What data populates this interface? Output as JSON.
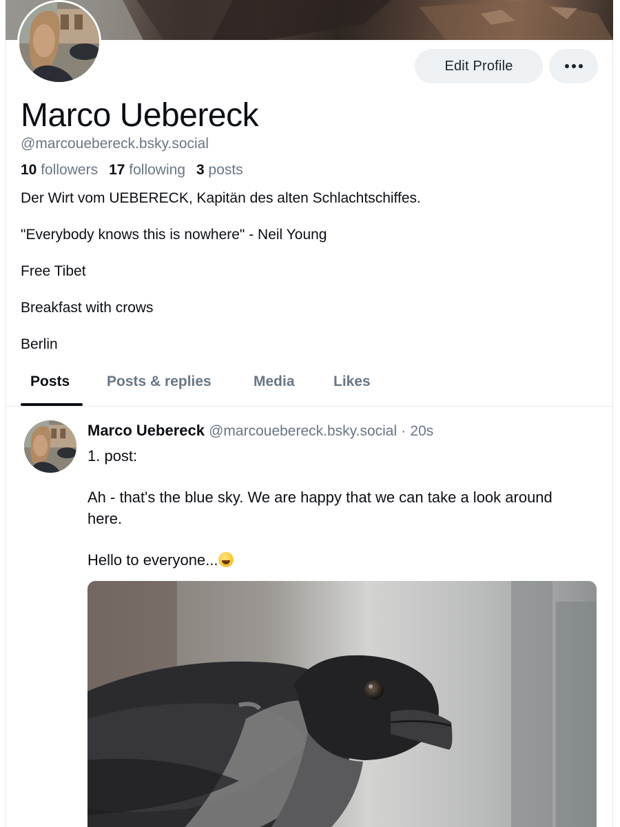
{
  "profile": {
    "name": "Marco Uebereck",
    "handle": "@marcouebereck.bsky.social",
    "followers_count": "10",
    "followers_label": "followers",
    "following_count": "17",
    "following_label": "following",
    "posts_count": "3",
    "posts_label": "posts",
    "bio": [
      "Der Wirt vom UEBERECK, Kapitän des alten Schlachtschiffes.",
      "\"Everybody knows this is nowhere\" - Neil Young",
      "Free Tibet",
      "Breakfast with crows",
      "Berlin"
    ]
  },
  "header": {
    "edit_profile_label": "Edit Profile",
    "more_icon": "more-horizontal-icon"
  },
  "tabs": [
    {
      "label": "Posts",
      "active": true
    },
    {
      "label": "Posts & replies",
      "active": false
    },
    {
      "label": "Media",
      "active": false
    },
    {
      "label": "Likes",
      "active": false
    }
  ],
  "post": {
    "author": "Marco Uebereck",
    "handle": "@marcouebereck.bsky.social",
    "separator": "·",
    "time": "20s",
    "lines": [
      "1. post:",
      "Ah - that's the blue sky. We are happy that we can take a look around here.",
      "Hello to everyone..."
    ],
    "emoji": "grinning-sweat-emoji"
  },
  "colors": {
    "text": "#0b0f14",
    "muted": "#687685",
    "button_bg": "#eef1f4",
    "border": "#e6e8eb"
  }
}
